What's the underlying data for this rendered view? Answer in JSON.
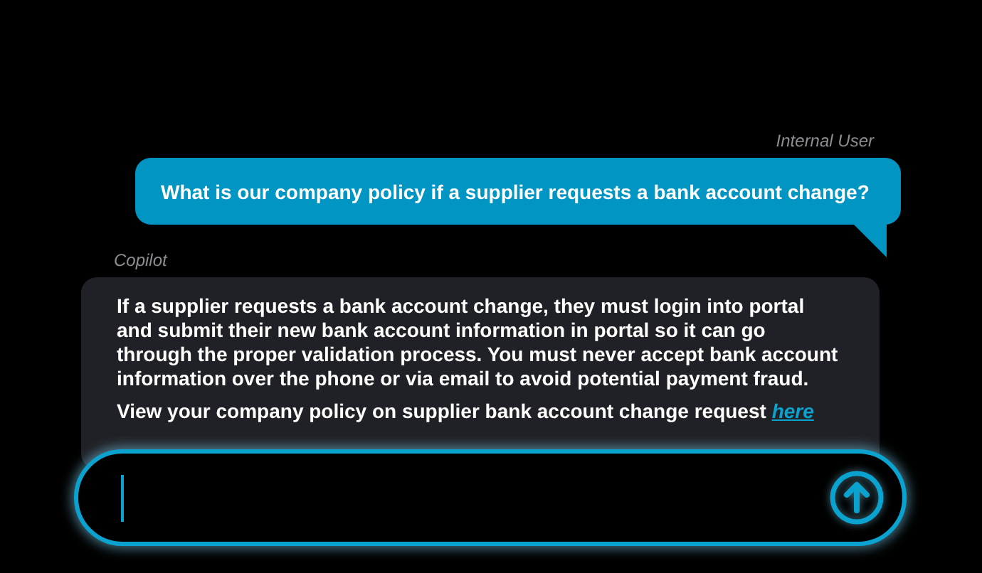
{
  "messages": [
    {
      "kind": "user",
      "author": "Internal User",
      "text": "What is our company policy if a supplier requests a bank account change?"
    },
    {
      "kind": "assistant",
      "author": "Copilot",
      "text": "If a supplier requests a bank account change, they must login into portal and submit their new bank account information in portal so it can go through the proper validation process. You must never accept bank account information over the phone or via email to avoid potential payment fraud.",
      "link_sentence": "View your company policy on supplier bank account change request",
      "link": "here"
    }
  ],
  "composer": {
    "focused": true
  }
}
